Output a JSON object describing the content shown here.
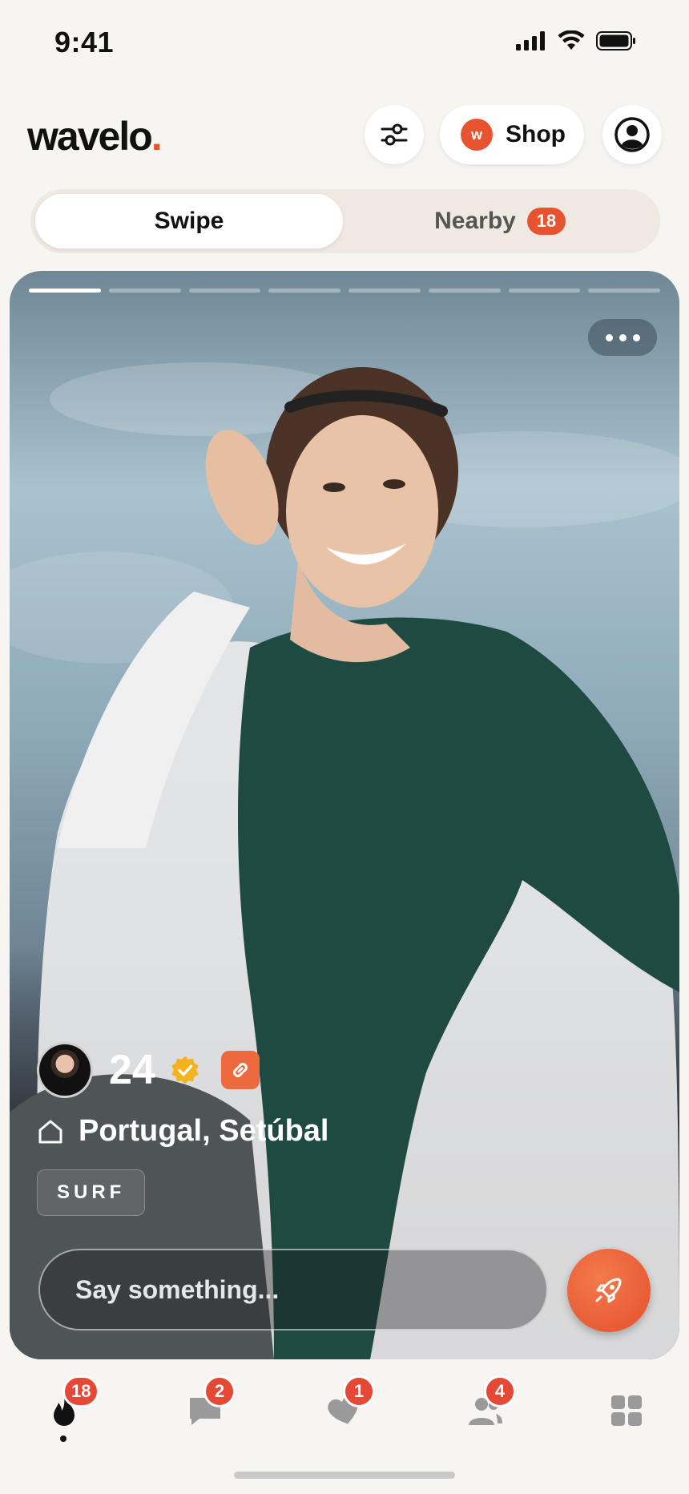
{
  "status_bar": {
    "time": "9:41"
  },
  "header": {
    "logo": "wavelo",
    "logo_dot": ".",
    "shop_badge_letter": "w",
    "shop_label": "Shop"
  },
  "tabs": [
    {
      "label": "Swipe",
      "active": true
    },
    {
      "label": "Nearby",
      "badge": "18",
      "active": false
    }
  ],
  "card": {
    "photo_count": 8,
    "current_photo": 1,
    "age": "24",
    "location": "Portugal, Setúbal",
    "tag": "SURF",
    "message_placeholder": "Say something..."
  },
  "bottom_nav": [
    {
      "icon": "flame-icon",
      "badge": "18",
      "active": true
    },
    {
      "icon": "chat-icon",
      "badge": "2"
    },
    {
      "icon": "heart-icon",
      "badge": "1"
    },
    {
      "icon": "people-icon",
      "badge": "4"
    },
    {
      "icon": "grid-icon"
    }
  ],
  "colors": {
    "accent": "#e8532f",
    "badge": "#e54834",
    "background": "#f7f5f2"
  }
}
